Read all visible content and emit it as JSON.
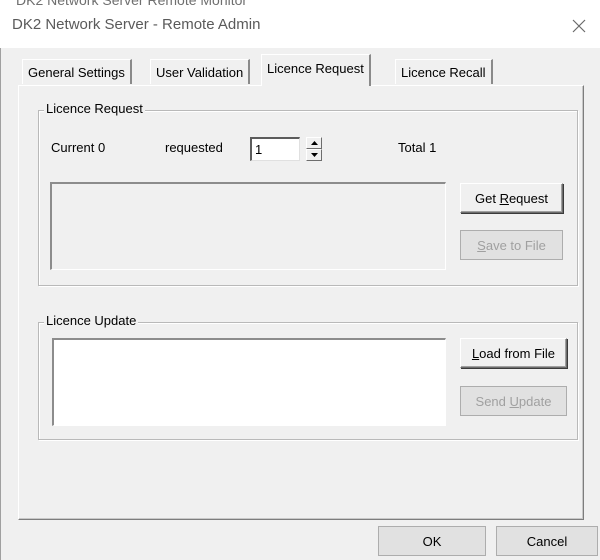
{
  "window": {
    "title": "DK2 Network Server - Remote Admin",
    "behind_title": "DK2 Network Server Remote Monitor"
  },
  "tabs": [
    {
      "label": "General Settings",
      "active": false
    },
    {
      "label": "User Validation",
      "active": false
    },
    {
      "label": "Licence Request",
      "active": true
    },
    {
      "label": "Licence Recall",
      "active": false
    }
  ],
  "licence_request": {
    "group_label": "Licence Request",
    "current_label": "Current 0",
    "requested_label": "requested",
    "requested_value": "1",
    "total_label": "Total 1",
    "get_request_button": {
      "prefix": "Get ",
      "accel": "R",
      "suffix": "equest"
    },
    "save_to_file_button": {
      "prefix": "",
      "accel": "S",
      "suffix": "ave to File"
    }
  },
  "licence_update": {
    "group_label": "Licence Update",
    "load_from_file_button": {
      "prefix": "",
      "accel": "L",
      "suffix": "oad from File"
    },
    "send_update_button": {
      "prefix": "Send ",
      "accel": "U",
      "suffix": "pdate"
    }
  },
  "footer": {
    "ok_label": "OK",
    "cancel_label": "Cancel"
  },
  "icons": {
    "close": "close-icon",
    "spin_up": "chevron-up-icon",
    "spin_down": "chevron-down-icon"
  },
  "colors": {
    "dialog_bg": "#f0f0f0",
    "disabled_text": "#a0a0a0"
  }
}
